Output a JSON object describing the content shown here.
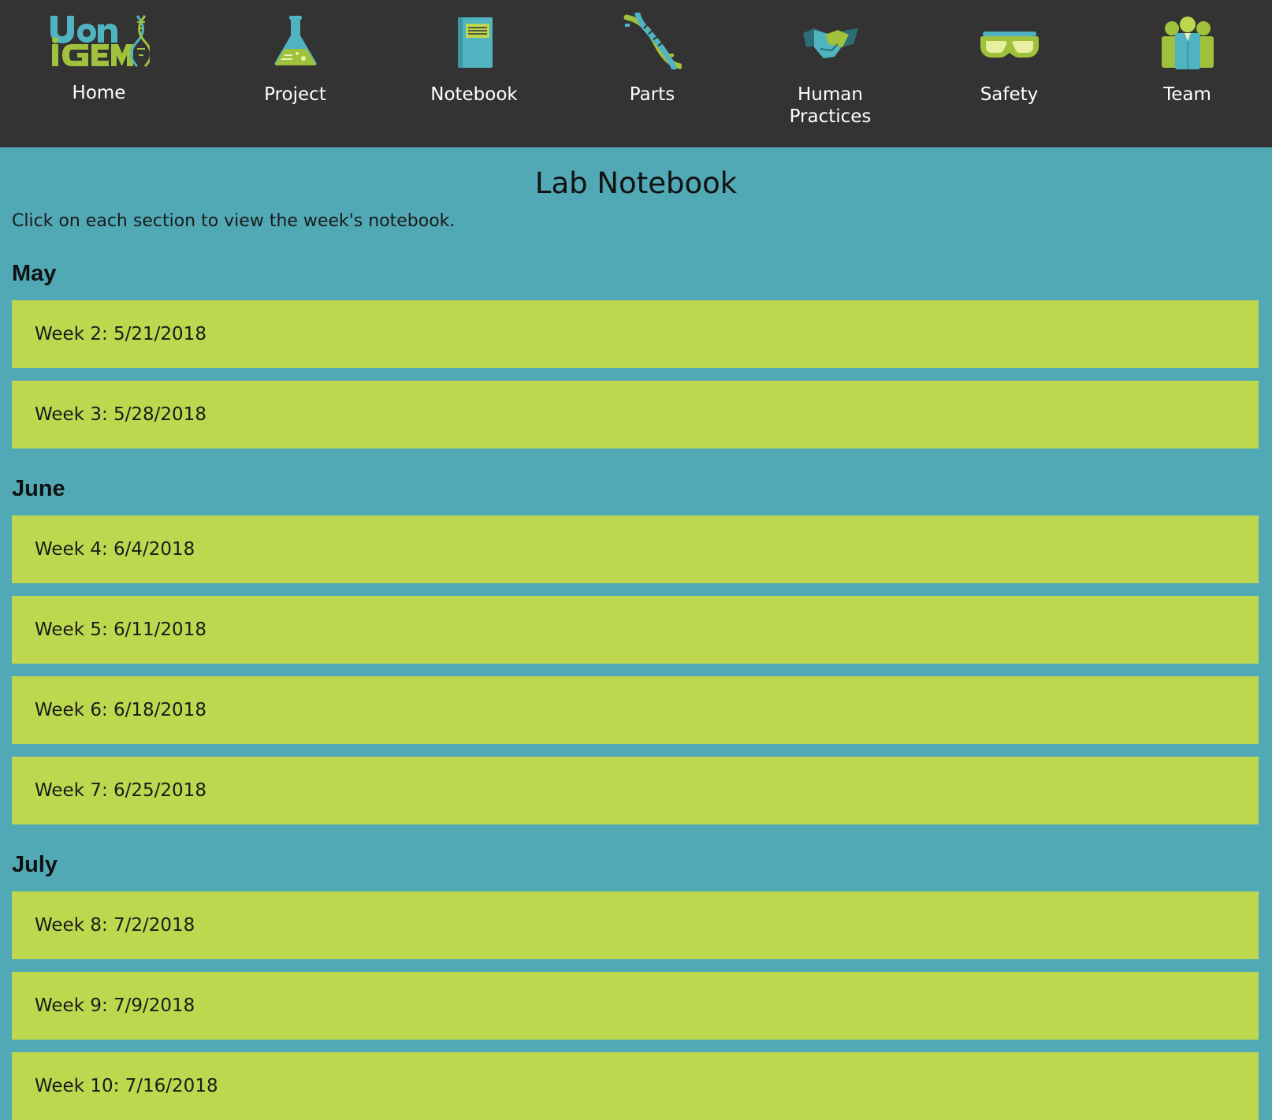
{
  "nav": {
    "items": [
      {
        "label": "Home",
        "icon": "uconn-igem-logo"
      },
      {
        "label": "Project",
        "icon": "flask-icon"
      },
      {
        "label": "Notebook",
        "icon": "notebook-icon"
      },
      {
        "label": "Parts",
        "icon": "dna-icon"
      },
      {
        "label": "Human\nPractices",
        "icon": "handshake-icon"
      },
      {
        "label": "Safety",
        "icon": "goggles-icon"
      },
      {
        "label": "Team",
        "icon": "team-icon"
      }
    ],
    "logo_text": {
      "line1": "UCONN",
      "line2": "iGEM"
    }
  },
  "page": {
    "title": "Lab Notebook",
    "intro": "Click on each section to view the week's notebook."
  },
  "months": [
    {
      "name": "May",
      "weeks": [
        "Week 2: 5/21/2018",
        "Week 3: 5/28/2018"
      ]
    },
    {
      "name": "June",
      "weeks": [
        "Week 4: 6/4/2018",
        "Week 5: 6/11/2018",
        "Week 6: 6/18/2018",
        "Week 7: 6/25/2018"
      ]
    },
    {
      "name": "July",
      "weeks": [
        "Week 8: 7/2/2018",
        "Week 9: 7/9/2018",
        "Week 10: 7/16/2018"
      ]
    }
  ],
  "colors": {
    "nav_background": "#333333",
    "page_background": "#51a9b6",
    "week_bar": "#bdd84f",
    "accent_teal": "#4fb3c1",
    "accent_green": "#9fc13b"
  }
}
